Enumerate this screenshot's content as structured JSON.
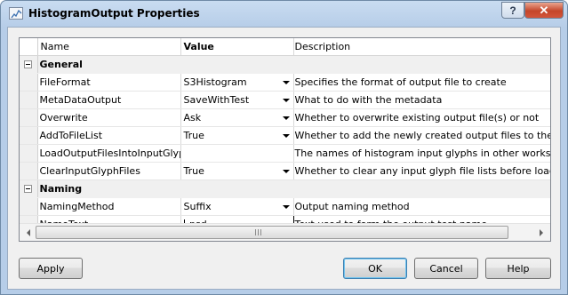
{
  "window": {
    "title": "HistogramOutput Properties",
    "help_label": "?",
    "close_label": "✕"
  },
  "grid": {
    "columns": [
      "Name",
      "Value",
      "Description"
    ],
    "categories": [
      {
        "name": "General",
        "rows": [
          {
            "name": "FileFormat",
            "value": "S3Histogram",
            "dropdown": true,
            "description": "Specifies the format of output file to create"
          },
          {
            "name": "MetaDataOutput",
            "value": "SaveWithTest",
            "dropdown": true,
            "description": "What to do with the metadata"
          },
          {
            "name": "Overwrite",
            "value": "Ask",
            "dropdown": true,
            "description": "Whether to overwrite existing output file(s) or not"
          },
          {
            "name": "AddToFileList",
            "value": "True",
            "dropdown": true,
            "description": "Whether to add the newly created output files to the file list"
          },
          {
            "name": "LoadOutputFilesIntoInputGlyph",
            "value": "",
            "dropdown": false,
            "description": "The names of histogram input glyphs in other workspaces to l"
          },
          {
            "name": "ClearInputGlyphFiles",
            "value": "True",
            "dropdown": true,
            "description": "Whether to clear any input glyph file lists before loading with"
          }
        ]
      },
      {
        "name": "Naming",
        "rows": [
          {
            "name": "NamingMethod",
            "value": "Suffix",
            "dropdown": true,
            "description": "Output naming method"
          },
          {
            "name": "NameText",
            "value": "_psd",
            "editing": true,
            "description": "Text used to form the output test name"
          }
        ]
      }
    ],
    "scrollbar": {
      "position": 0.0
    }
  },
  "buttons": {
    "apply": "Apply",
    "ok": "OK",
    "cancel": "Cancel",
    "help": "Help"
  },
  "colors": {
    "title_bar": "#b9d1ea",
    "close_button": "#c94f34",
    "category_row": "#f0f0f0",
    "ok_border": "#3c7fb1"
  }
}
